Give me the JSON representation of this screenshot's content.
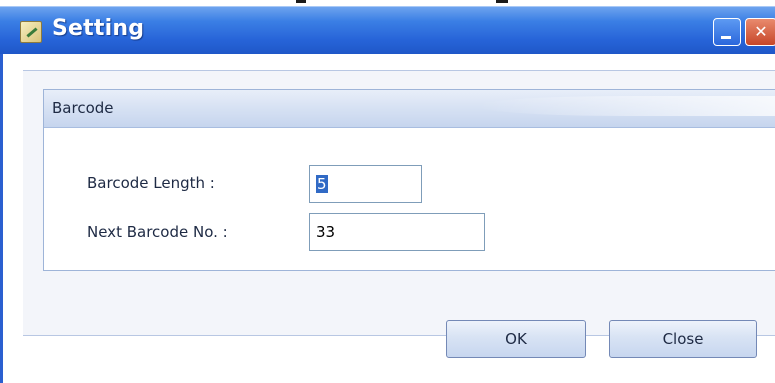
{
  "window": {
    "title": "Setting",
    "icons": [
      "app-icon",
      "minimize-icon",
      "close-icon"
    ],
    "colors": {
      "titlebar": "#2764d8",
      "panel": "#f3f5fa",
      "selection": "#316ac5"
    }
  },
  "group": {
    "title": "Barcode",
    "fields": [
      {
        "label": "Barcode Length :",
        "value": "5"
      },
      {
        "label": "Next Barcode No. :",
        "value": "33"
      }
    ]
  },
  "buttons": {
    "ok": "OK",
    "close": "Close"
  }
}
